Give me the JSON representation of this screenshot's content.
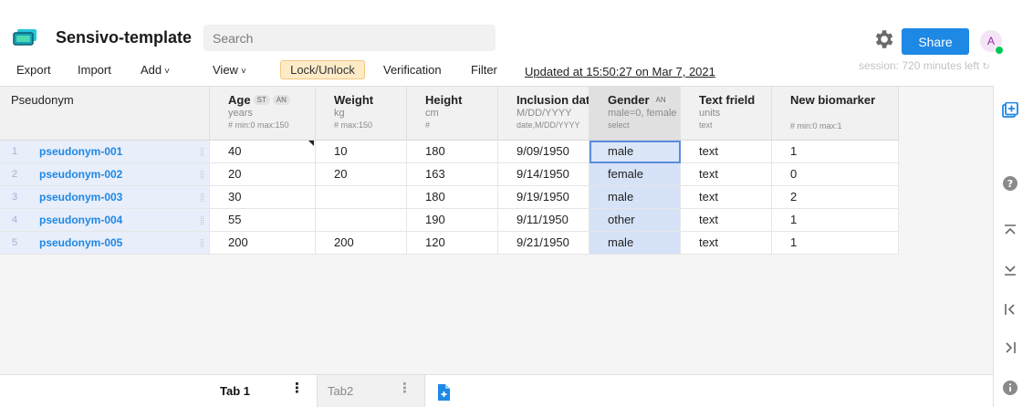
{
  "app": {
    "title": "Sensivo-template"
  },
  "search": {
    "placeholder": "Search"
  },
  "menu": {
    "export": "Export",
    "import": "Import",
    "add": "Add",
    "view": "View",
    "lock": "Lock/Unlock",
    "verification": "Verification",
    "filter": "Filter",
    "updated": "Updated at 15:50:27 on Mar 7, 2021"
  },
  "account": {
    "share": "Share",
    "avatar": "A",
    "session": "session: 720 minutes left"
  },
  "colors": {
    "accent": "#1e88e5",
    "lock_bg": "#fdebc8",
    "online": "#00c853",
    "row_header": "#e8eefa"
  },
  "columns": [
    {
      "name": "Pseudonym",
      "unit": "",
      "meta": "",
      "badges": []
    },
    {
      "name": "Age",
      "unit": "years",
      "meta": "# min:0 max:150",
      "badges": [
        "ST",
        "AN"
      ]
    },
    {
      "name": "Weight",
      "unit": "kg",
      "meta": "# max:150",
      "badges": []
    },
    {
      "name": "Height",
      "unit": "cm",
      "meta": "#",
      "badges": []
    },
    {
      "name": "Inclusion dat",
      "unit": "M/DD/YYYY",
      "meta": "date,M/DD/YYYY",
      "badges": []
    },
    {
      "name": "Gender",
      "unit": "male=0, female",
      "meta": "select",
      "badges": [
        "AN"
      ]
    },
    {
      "name": "Text frield",
      "unit": "units",
      "meta": "text",
      "badges": []
    },
    {
      "name": "New biomarker",
      "unit": "",
      "meta": "# min:0 max:1",
      "badges": []
    }
  ],
  "rows": [
    {
      "num": "1",
      "pseudonym": "pseudonym-001",
      "age": "40",
      "weight": "10",
      "height": "180",
      "date": "9/09/1950",
      "gender": "male",
      "text": "text",
      "bio": "1"
    },
    {
      "num": "2",
      "pseudonym": "pseudonym-002",
      "age": "20",
      "weight": "20",
      "height": "163",
      "date": "9/14/1950",
      "gender": "female",
      "text": "text",
      "bio": "0"
    },
    {
      "num": "3",
      "pseudonym": "pseudonym-003",
      "age": "30",
      "weight": "",
      "height": "180",
      "date": "9/19/1950",
      "gender": "male",
      "text": "text",
      "bio": "2"
    },
    {
      "num": "4",
      "pseudonym": "pseudonym-004",
      "age": "55",
      "weight": "",
      "height": "190",
      "date": "9/11/1950",
      "gender": "other",
      "text": "text",
      "bio": "1"
    },
    {
      "num": "5",
      "pseudonym": "pseudonym-005",
      "age": "200",
      "weight": "200",
      "height": "120",
      "date": "9/21/1950",
      "gender": "male",
      "text": "text",
      "bio": "1"
    }
  ],
  "tabs": [
    {
      "label": "Tab 1",
      "active": true
    },
    {
      "label": "Tab2",
      "active": false
    }
  ],
  "rail_icons": [
    "add-column-icon",
    "help-icon",
    "scroll-top-icon",
    "scroll-bottom-icon",
    "scroll-first-icon",
    "scroll-last-icon",
    "info-icon"
  ]
}
